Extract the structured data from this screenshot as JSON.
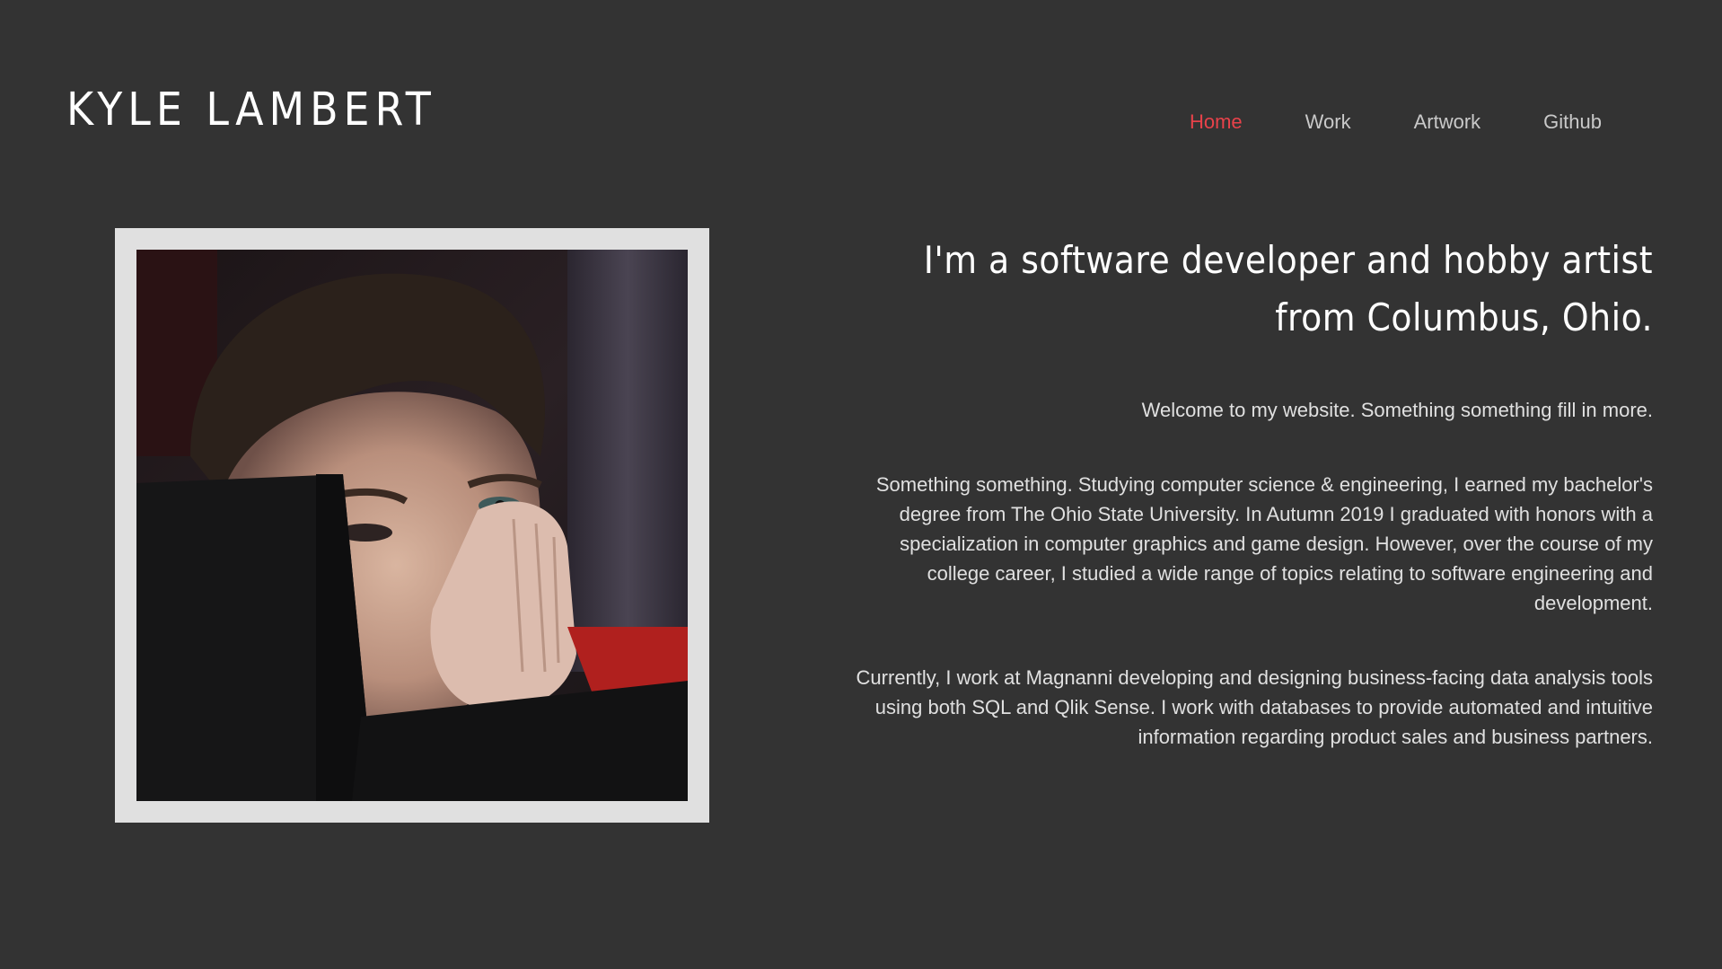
{
  "header": {
    "site_title": "KYLE LAMBERT",
    "nav": [
      {
        "label": "Home",
        "active": true
      },
      {
        "label": "Work",
        "active": false
      },
      {
        "label": "Artwork",
        "active": false
      },
      {
        "label": "Github",
        "active": false
      }
    ]
  },
  "colors": {
    "background": "#333333",
    "accent": "#e8424a",
    "frame": "#e0e0e0"
  },
  "main": {
    "headline": "I'm a software developer and hobby artist from Columbus, Ohio.",
    "paragraphs": [
      "Welcome to my website. Something something fill in more.",
      "Something something. Studying computer science & engineering, I earned my bachelor's degree from The Ohio State University. In Autumn 2019 I graduated with honors with a specialization in computer graphics and game design. However, over the course of my college career, I studied a wide range of topics relating to software engineering and development.",
      "Currently, I work at Magnanni developing and designing business-facing data analysis tools using both SQL and Qlik Sense. I work with databases to provide automated and intuitive information regarding product sales and business partners."
    ]
  }
}
